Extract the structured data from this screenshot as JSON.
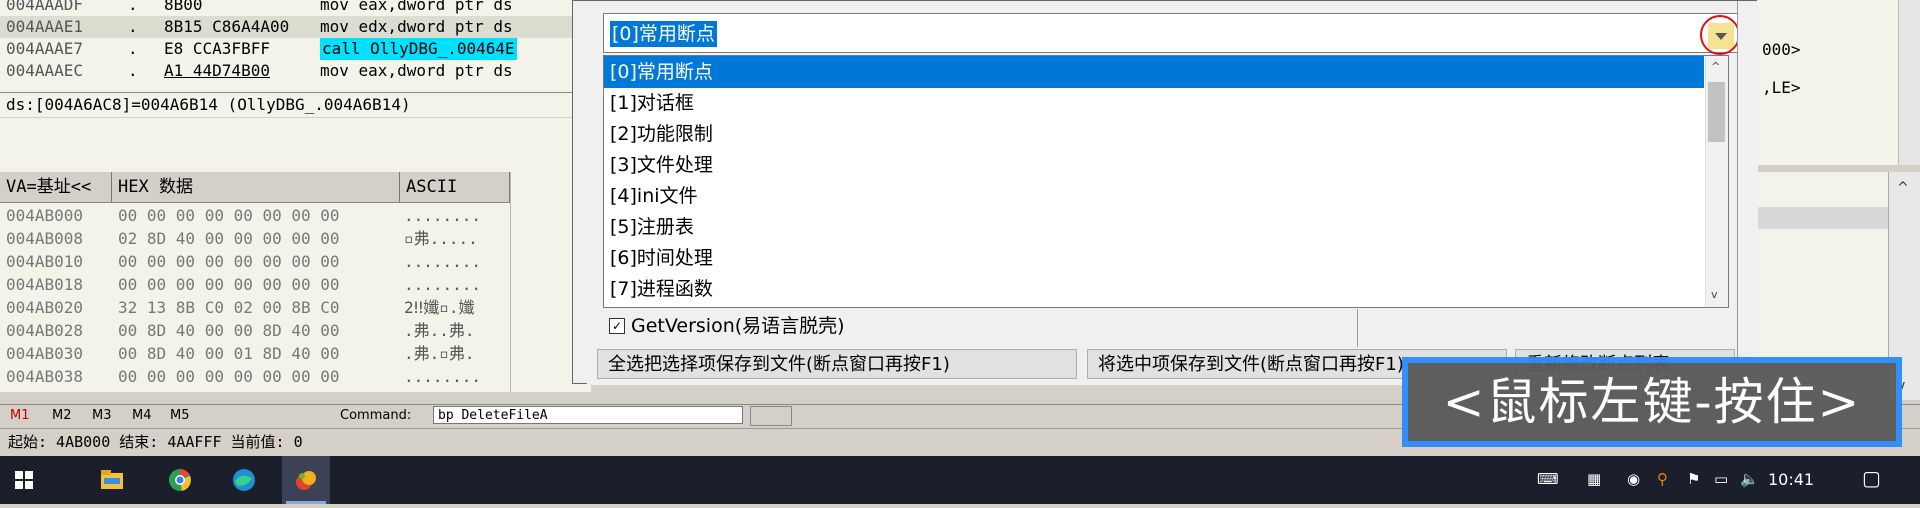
{
  "disasm": {
    "rows": [
      {
        "addr": "004AAADF",
        "dot": ".",
        "hex": "8B00",
        "ins": "mov eax,dword ptr ds"
      },
      {
        "addr": "004AAAE1",
        "dot": ".",
        "hex": "8B15 C86A4A00",
        "ins": "mov edx,dword ptr ds"
      },
      {
        "addr": "004AAAE7",
        "dot": ".",
        "hex": "E8 CCA3FBFF",
        "ins": "call OllyDBG_.00464E"
      },
      {
        "addr": "004AAAEC",
        "dot": ".",
        "hex": "A1 44D74B00",
        "ins": "mov eax,dword ptr ds"
      }
    ],
    "info": "ds:[004A6AC8]=004A6B14 (OllyDBG_.004A6B14)"
  },
  "right_pane": {
    "line1": "000>",
    "line2": ",LE>"
  },
  "dump": {
    "headers": [
      "VA=基址<<",
      "HEX 数据",
      "ASCII"
    ],
    "rows": [
      {
        "addr": "004AB000",
        "hex": "00 00 00 00 00 00 00 00",
        "ascii": "........"
      },
      {
        "addr": "004AB008",
        "hex": "02 8D 40 00 00 00 00 00",
        "ascii": "▫弗....."
      },
      {
        "addr": "004AB010",
        "hex": "00 00 00 00 00 00 00 00",
        "ascii": "........"
      },
      {
        "addr": "004AB018",
        "hex": "00 00 00 00 00 00 00 00",
        "ascii": "........"
      },
      {
        "addr": "004AB020",
        "hex": "32 13 8B C0 02 00 8B C0",
        "ascii": "2‼孅▫.孅"
      },
      {
        "addr": "004AB028",
        "hex": "00 8D 40 00 00 8D 40 00",
        "ascii": ".弗..弗."
      },
      {
        "addr": "004AB030",
        "hex": "00 8D 40 00 01 8D 40 00",
        "ascii": ".弗.▫弗."
      },
      {
        "addr": "004AB038",
        "hex": "00 00 00 00 00 00 00 00",
        "ascii": "........"
      }
    ]
  },
  "command_bar": {
    "tabs": [
      "M1",
      "M2",
      "M3",
      "M4",
      "M5"
    ],
    "label": "Command:",
    "value": "bp DeleteFileA"
  },
  "status": {
    "text": "起始: 4AB000 结束: 4AAFFF 当前值: 0"
  },
  "dialog": {
    "dropdown_value": "[0]常用断点",
    "options": [
      "[0]常用断点",
      "[1]对话框",
      "[2]功能限制",
      "[3]文件处理",
      "[4]ini文件",
      "[5]注册表",
      "[6]时间处理",
      "[7]进程函数"
    ],
    "selected_index": 0,
    "checkbox_label": "GetVersion(易语言脱壳)",
    "checkbox_checked": true,
    "buttons": [
      "全选把选择项保存到文件(断点窗口再按F1)",
      "将选中项保存到文件(断点窗口再按F1)",
      "重新修改断点列表"
    ]
  },
  "overlay": {
    "text": "<鼠标左键-按住>",
    "border_color": "#2d8cff"
  },
  "taskbar": {
    "icons": [
      "windows-start-icon",
      "file-explorer-icon",
      "chrome-icon",
      "edge-icon",
      "ollydbg-icon"
    ],
    "tray": [
      "keyboard-icon",
      "app-tray-icon",
      "network-globe-icon",
      "search-tray-icon",
      "notification-icon",
      "volume-icon"
    ],
    "time": "10:41"
  }
}
